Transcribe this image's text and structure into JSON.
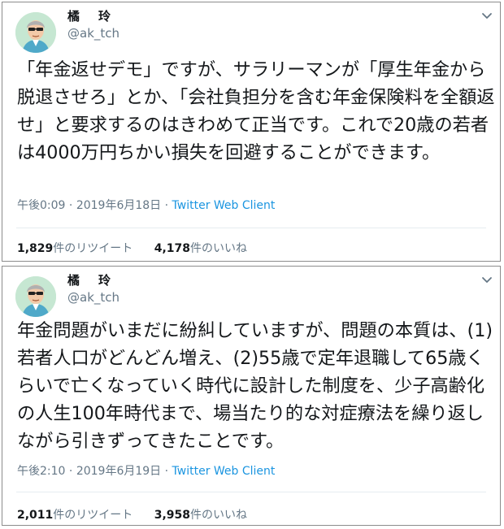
{
  "tweets": [
    {
      "user": {
        "name": "橘　玲",
        "handle": "@ak_tch"
      },
      "text": "「年金返せデモ」ですが、サラリーマンが「厚生年金から脱退させろ」とか、「会社負担分を含む年金保険料を全額返せ」と要求するのはきわめて正当です。これで20歳の若者は4000万円ちかい損失を回避することができます。",
      "time": "午後0:09",
      "separator": "·",
      "date": "2019年6月18日",
      "client": "Twitter Web Client",
      "retweets": {
        "count": "1,829",
        "label": "件のリツイート"
      },
      "likes": {
        "count": "4,178",
        "label": "件のいいね"
      }
    },
    {
      "user": {
        "name": "橘　玲",
        "handle": "@ak_tch"
      },
      "text": "年金問題がいまだに紛糾していますが、問題の本質は、(1)若者人口がどんどん増え、(2)55歳で定年退職して65歳くらいで亡くなっていく時代に設計した制度を、少子高齢化の人生100年時代まで、場当たり的な対症療法を繰り返しながら引きずってきたことです。",
      "time": "午後2:10",
      "separator": "·",
      "date": "2019年6月19日",
      "client": "Twitter Web Client",
      "retweets": {
        "count": "2,011",
        "label": "件のリツイート"
      },
      "likes": {
        "count": "3,958",
        "label": "件のいいね"
      }
    }
  ],
  "colors": {
    "text": "#14171a",
    "secondary": "#657786",
    "link": "#1b95e0",
    "avatar_bg": "#c6e7d2",
    "avatar_shirt": "#4fa9c9"
  },
  "icons": {
    "avatar": "user-avatar",
    "menu": "chevron-down-icon"
  }
}
